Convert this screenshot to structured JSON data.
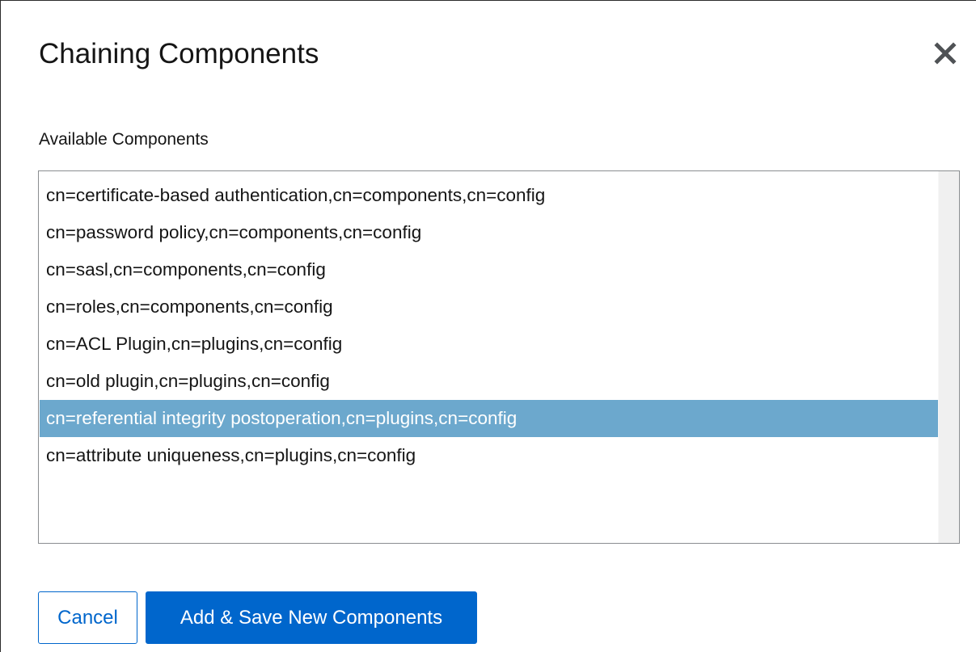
{
  "dialog": {
    "title": "Chaining Components",
    "close_icon": "close-icon"
  },
  "available": {
    "label": "Available Components",
    "options": [
      "cn=certificate-based authentication,cn=components,cn=config",
      "cn=password policy,cn=components,cn=config",
      "cn=sasl,cn=components,cn=config",
      "cn=roles,cn=components,cn=config",
      "cn=ACL Plugin,cn=plugins,cn=config",
      "cn=old plugin,cn=plugins,cn=config",
      "cn=referential integrity postoperation,cn=plugins,cn=config",
      "cn=attribute uniqueness,cn=plugins,cn=config"
    ],
    "selected_option": "cn=referential integrity postoperation,cn=plugins,cn=config"
  },
  "footer": {
    "cancel_label": "Cancel",
    "save_label": "Add & Save New Components"
  },
  "colors": {
    "primary": "#0066cc",
    "selection": "#6ca8cd",
    "text": "#151515"
  }
}
